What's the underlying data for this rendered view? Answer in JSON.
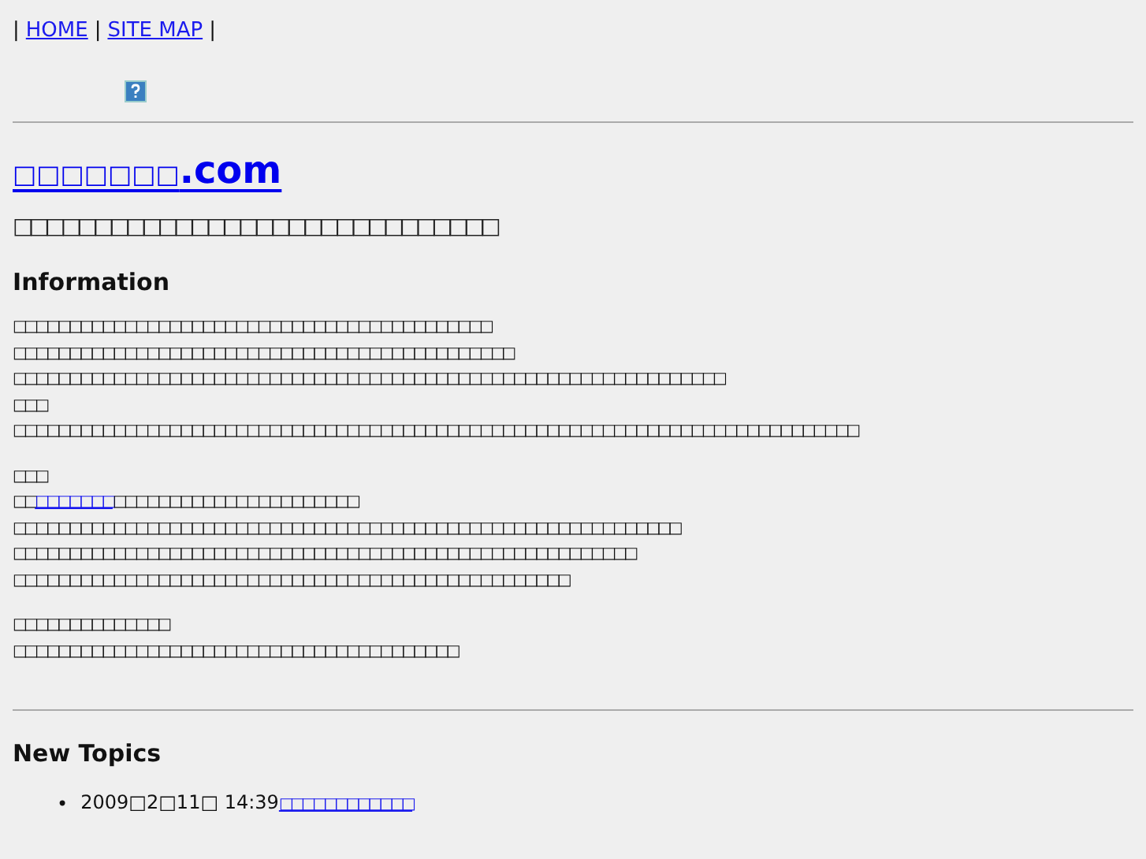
{
  "nav": {
    "separator": "|",
    "links": [
      "HOME",
      "SITE MAP"
    ]
  },
  "site_title": {
    "link": "□□□□□□□",
    "suffix": ".com"
  },
  "subtitle": "□□□□□□□□□□□□□□□□□□□□□□□□□□□□□□",
  "information": {
    "heading": "Information",
    "paragraphs": [
      [
        {
          "kind": "text",
          "text": "□□□□□□□□□□□□□□□□□□□□□□□□□□□□□□□□□□□□□□□□□□□"
        },
        {
          "kind": "text",
          "text": "□□□□□□□□□□□□□□□□□□□□□□□□□□□□□□□□□□□□□□□□□□□□□"
        },
        {
          "kind": "text",
          "text": "□□□□□□□□□□□□□□□□□□□□□□□□□□□□□□□□□□□□□□□□□□□□□□□□□□□□□□□□□□□□□□□□"
        },
        {
          "kind": "text",
          "text": "□□□"
        },
        {
          "kind": "text",
          "text": "□□□□□□□□□□□□□□□□□□□□□□□□□□□□□□□□□□□□□□□□□□□□□□□□□□□□□□□□□□□□□□□□□□□□□□□□□□□□"
        }
      ],
      [
        {
          "kind": "text",
          "text": "□□□"
        },
        {
          "kind": "link_line",
          "prefix": "□□",
          "link": "□□□□□□□",
          "rest": "□□□□□□□□□□□□□□□□□□□□□□"
        },
        {
          "kind": "text",
          "text": "□□□□□□□□□□□□□□□□□□□□□□□□□□□□□□□□□□□□□□□□□□□□□□□□□□□□□□□□□□□□"
        },
        {
          "kind": "text",
          "text": "□□□□□□□□□□□□□□□□□□□□□□□□□□□□□□□□□□□□□□□□□□□□□□□□□□□□□□□□"
        },
        {
          "kind": "text",
          "text": "□□□□□□□□□□□□□□□□□□□□□□□□□□□□□□□□□□□□□□□□□□□□□□□□□□"
        }
      ],
      [
        {
          "kind": "text",
          "text": "□□□□□□□□□□□□□□"
        },
        {
          "kind": "text",
          "text": "□□□□□□□□□□□□□□□□□□□□□□□□□□□□□□□□□□□□□□□□"
        }
      ]
    ]
  },
  "new_topics": {
    "heading": "New Topics",
    "items": [
      {
        "bullet": "•",
        "date": "2009□2□11□ 14:39",
        "title": "□□□□□□□□□□□□"
      }
    ]
  }
}
